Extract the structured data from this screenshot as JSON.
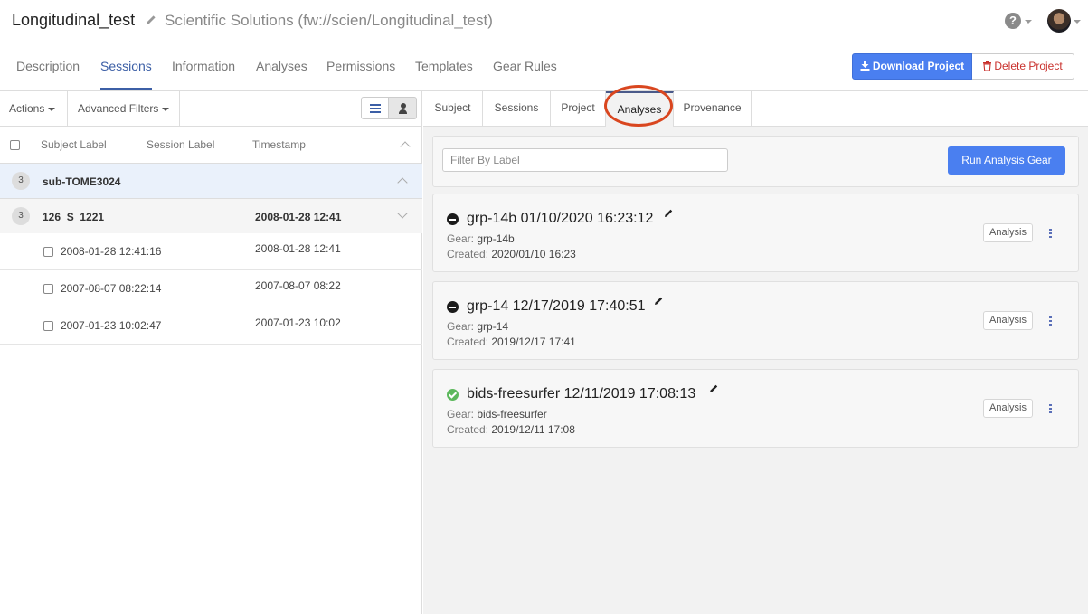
{
  "header": {
    "project_title": "Longitudinal_test",
    "project_path": "Scientific Solutions (fw://scien/Longitudinal_test)",
    "help_glyph": "?"
  },
  "main_tabs": [
    {
      "label": "Description"
    },
    {
      "label": "Sessions",
      "active": true
    },
    {
      "label": "Information"
    },
    {
      "label": "Analyses"
    },
    {
      "label": "Permissions"
    },
    {
      "label": "Templates"
    },
    {
      "label": "Gear Rules"
    }
  ],
  "project_actions": {
    "download_label": "Download Project",
    "delete_label": "Delete Project"
  },
  "left_toolbar": {
    "actions_label": "Actions",
    "filters_label": "Advanced Filters"
  },
  "table_headers": {
    "subject_label": "Subject Label",
    "session_label": "Session Label",
    "timestamp": "Timestamp"
  },
  "subject_row": {
    "count": "3",
    "label": "sub-TOME3024"
  },
  "session_row": {
    "count": "3",
    "label": "126_S_1221",
    "timestamp": "2008-01-28 12:41"
  },
  "acquisitions": [
    {
      "label": "2008-01-28 12:41:16",
      "timestamp": "2008-01-28 12:41"
    },
    {
      "label": "2007-08-07 08:22:14",
      "timestamp": "2007-08-07 08:22"
    },
    {
      "label": "2007-01-23 10:02:47",
      "timestamp": "2007-01-23 10:02"
    }
  ],
  "sub_tabs": [
    {
      "label": "Subject"
    },
    {
      "label": "Sessions"
    },
    {
      "label": "Project"
    },
    {
      "label": "Analyses",
      "active": true
    },
    {
      "label": "Provenance"
    }
  ],
  "filter": {
    "placeholder": "Filter By Label"
  },
  "run_button_label": "Run Analysis Gear",
  "analyses": [
    {
      "title": "grp-14b 01/10/2020 16:23:12",
      "gear_label": "Gear:",
      "gear": "grp-14b",
      "created_label": "Created:",
      "created": "2020/01/10 16:23",
      "status": "blocked-icon",
      "badge": "Analysis"
    },
    {
      "title": "grp-14 12/17/2019 17:40:51",
      "gear_label": "Gear:",
      "gear": "grp-14",
      "created_label": "Created:",
      "created": "2019/12/17 17:41",
      "status": "blocked-icon",
      "badge": "Analysis"
    },
    {
      "title": "bids-freesurfer 12/11/2019 17:08:13",
      "gear_label": "Gear:",
      "gear": "bids-freesurfer",
      "created_label": "Created:",
      "created": "2019/12/11 17:08",
      "status": "check-icon",
      "badge": "Analysis"
    }
  ],
  "colors": {
    "accent": "#4a7ff0",
    "active_tab": "#3c5fa6",
    "delete_red": "#c9302c",
    "highlight_ring": "#d9461f",
    "success": "#5cb85c"
  }
}
